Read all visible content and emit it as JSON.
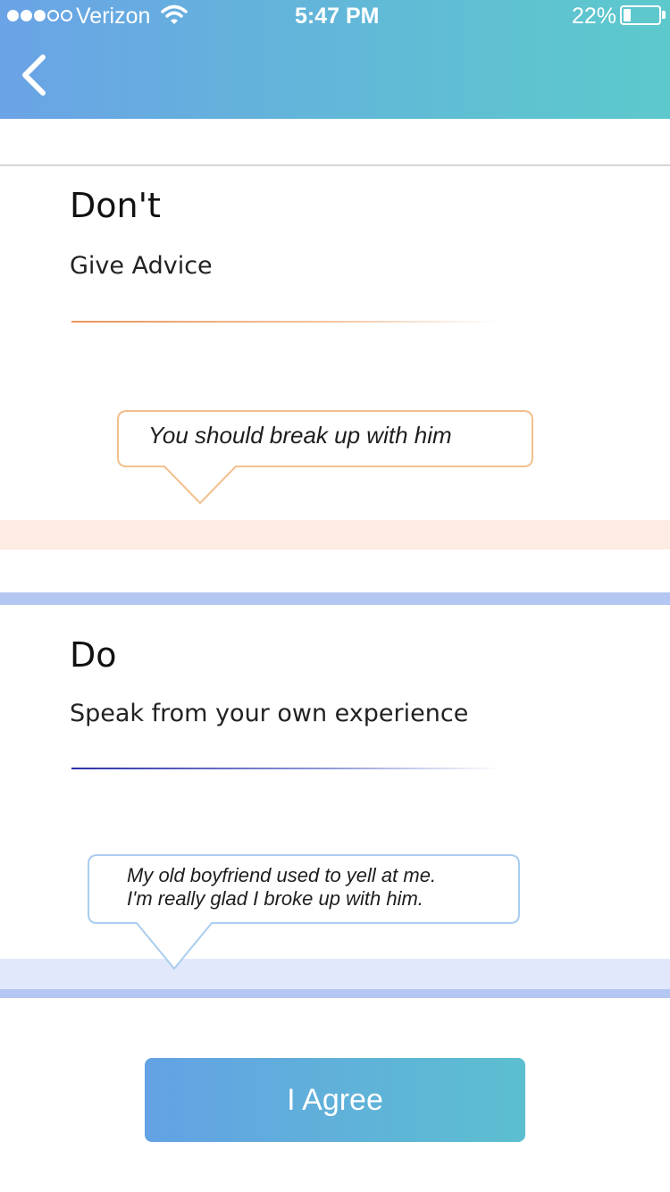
{
  "status_bar": {
    "carrier": "Verizon",
    "time": "5:47 PM",
    "battery": "22%",
    "signal_bars_filled": 3,
    "signal_bars_total": 5,
    "battery_level": 0.22
  },
  "header": {
    "back_icon": "chevron-left-icon",
    "gradient_start": "#6aa3e6",
    "gradient_end": "#5ec9cc"
  },
  "dont": {
    "title": "Don't",
    "subtitle": "Give Advice",
    "bubble_text": "You should break up with him",
    "accent_color": "#f2bf8e"
  },
  "do": {
    "title": "Do",
    "subtitle": "Speak from your own experience",
    "bubble_text": "My old boyfriend used to yell at me.\nI'm really glad I broke up with him.",
    "accent_color": "#a9cdee"
  },
  "agree_button": {
    "label": "I Agree"
  }
}
